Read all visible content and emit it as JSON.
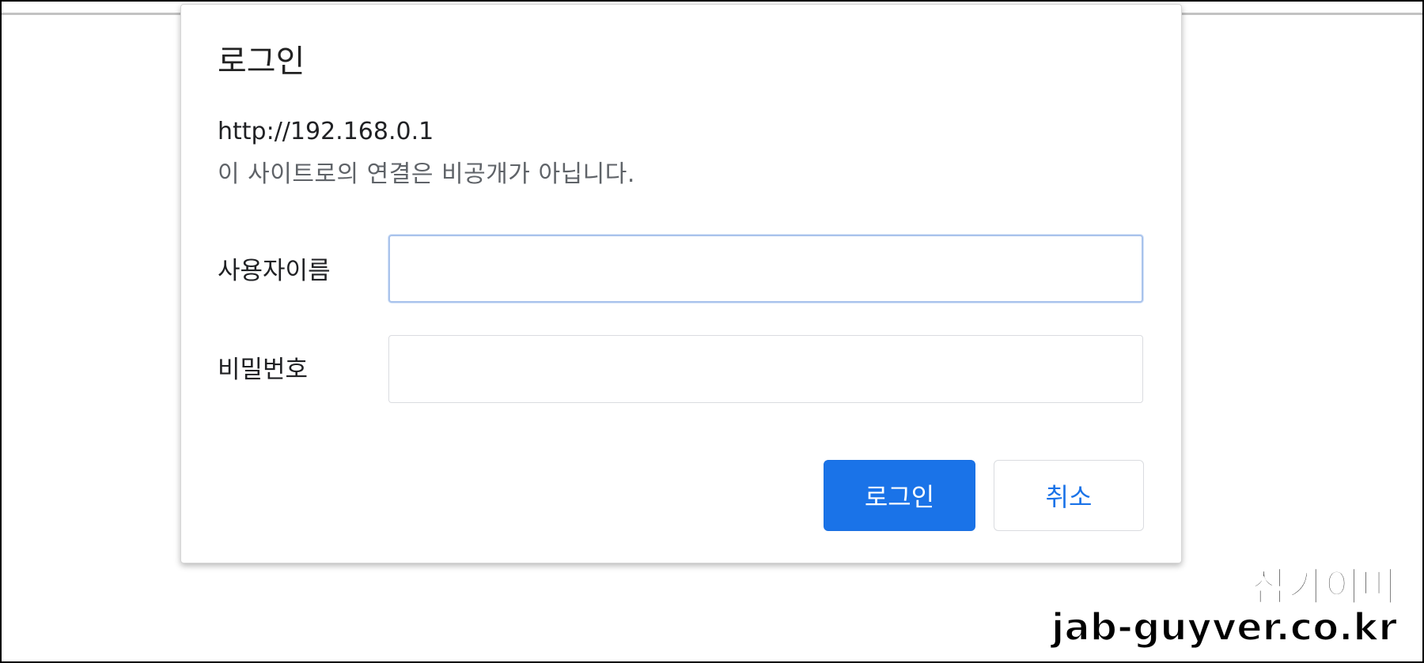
{
  "dialog": {
    "title": "로그인",
    "url": "http://192.168.0.1",
    "warning": "이 사이트로의 연결은 비공개가 아닙니다.",
    "username_label": "사용자이름",
    "username_value": "",
    "password_label": "비밀번호",
    "password_value": "",
    "login_button": "로그인",
    "cancel_button": "취소"
  },
  "watermark": {
    "name": "잡가이버",
    "site": "jab-guyver.co.kr"
  },
  "colors": {
    "primary": "#1a73e8",
    "focus_border": "#a9c3ec",
    "input_border": "#dadce0",
    "text_secondary": "#5f6368"
  }
}
